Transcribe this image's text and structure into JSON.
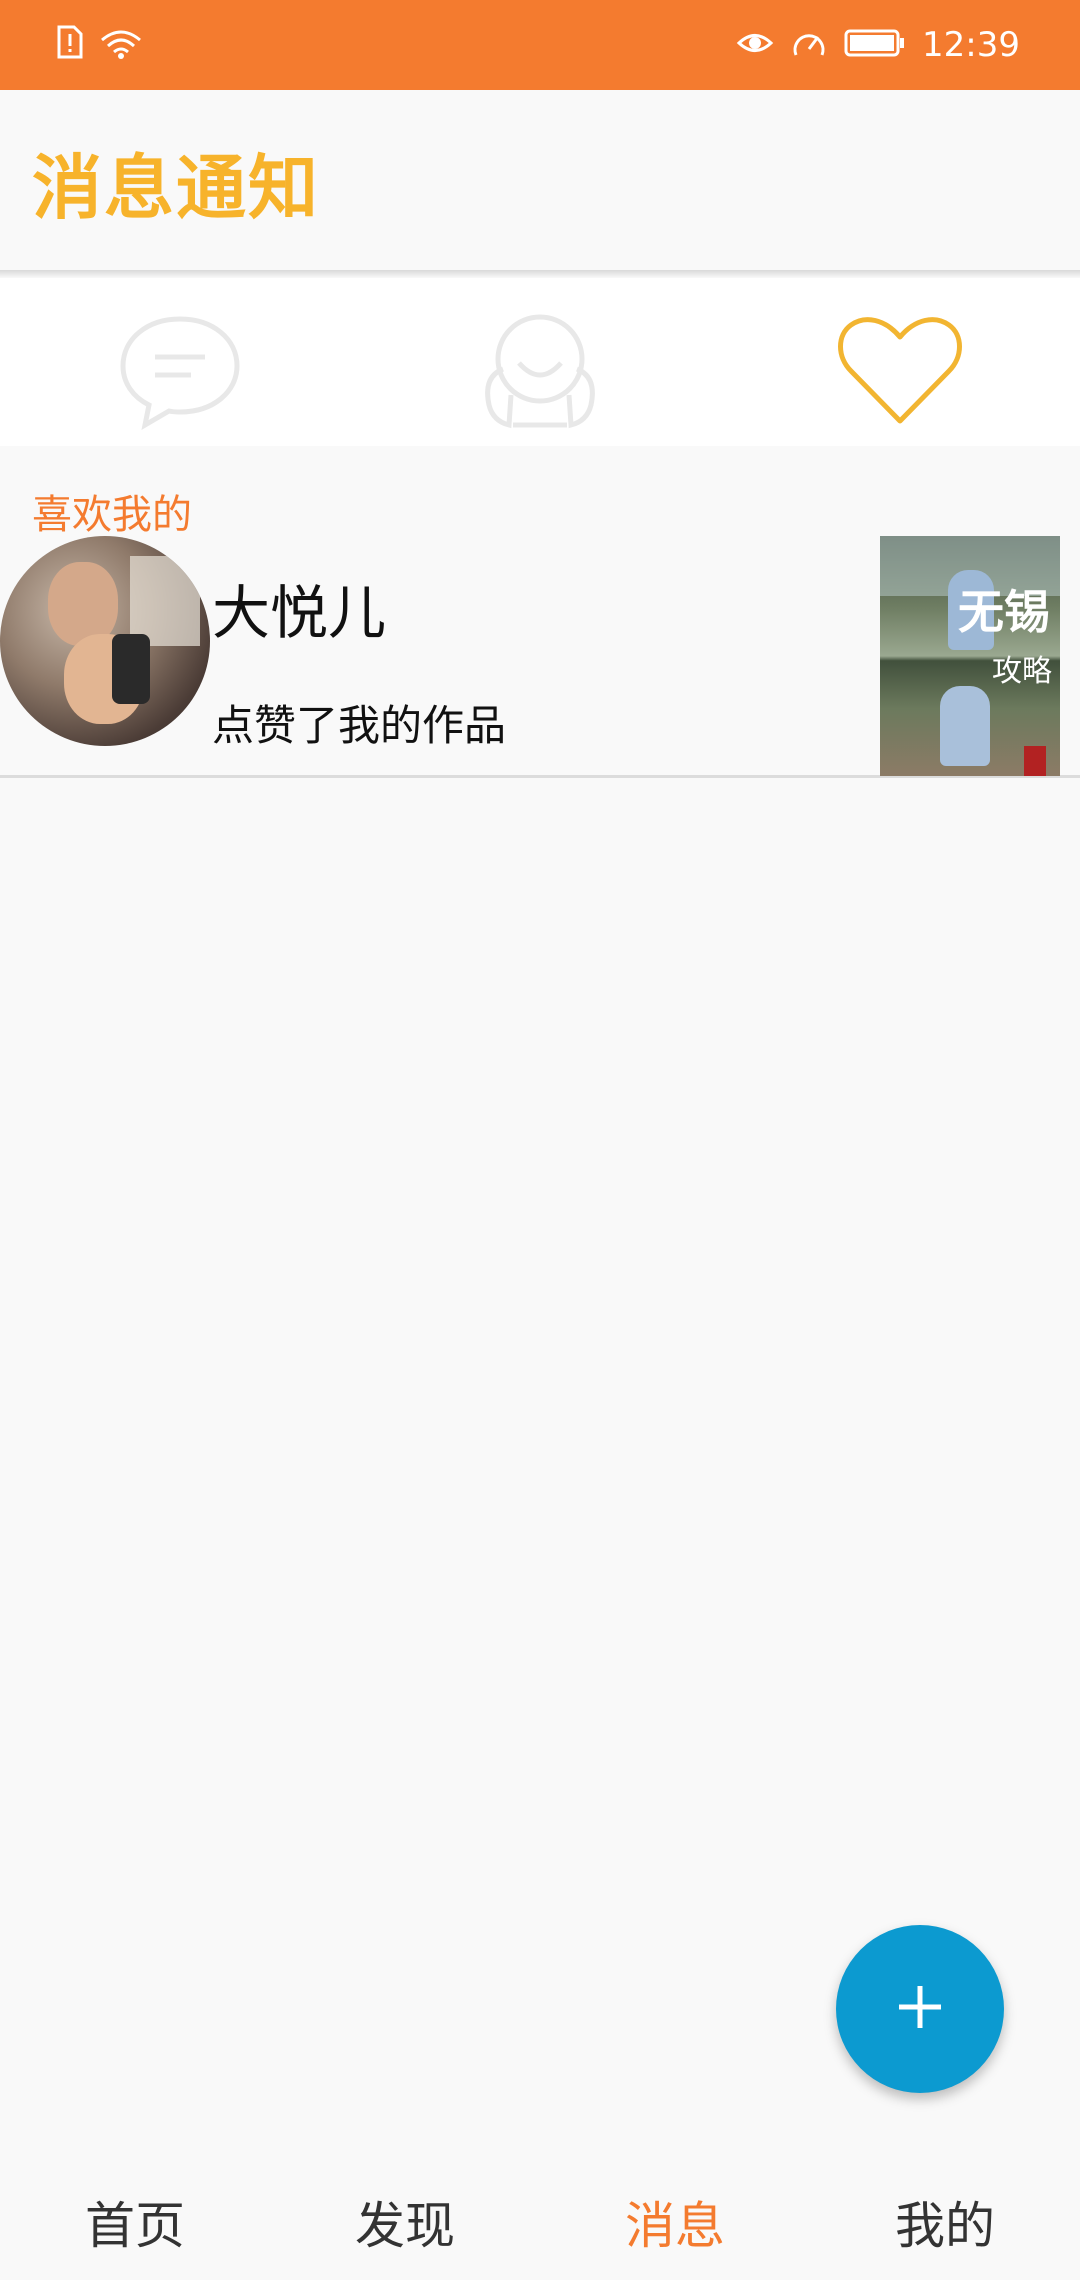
{
  "status_bar": {
    "time": "12:39",
    "icons": [
      "sim-alert-icon",
      "wifi-icon",
      "eye-icon",
      "speedometer-icon",
      "battery-icon"
    ],
    "background": "#f47b2f"
  },
  "header": {
    "title": "消息通知",
    "title_color": "#f7b32b"
  },
  "tabs": [
    {
      "icon": "comment-bubble-icon",
      "active": false
    },
    {
      "icon": "followers-icon",
      "active": false
    },
    {
      "icon": "heart-icon",
      "active": true,
      "active_color": "#f2b531"
    }
  ],
  "section": {
    "label": "喜欢我的"
  },
  "likes": [
    {
      "user_name": "大悦儿",
      "action": "点赞了我的作品",
      "thumbnail_text": [
        "无锡",
        "攻略"
      ]
    }
  ],
  "fab": {
    "icon": "plus-icon",
    "color": "#0c9ad0"
  },
  "bottom_nav": {
    "items": [
      {
        "label": "首页",
        "active": false
      },
      {
        "label": "发现",
        "active": false
      },
      {
        "label": "消息",
        "active": true
      },
      {
        "label": "我的",
        "active": false
      }
    ],
    "active_color": "#f47b2f"
  }
}
